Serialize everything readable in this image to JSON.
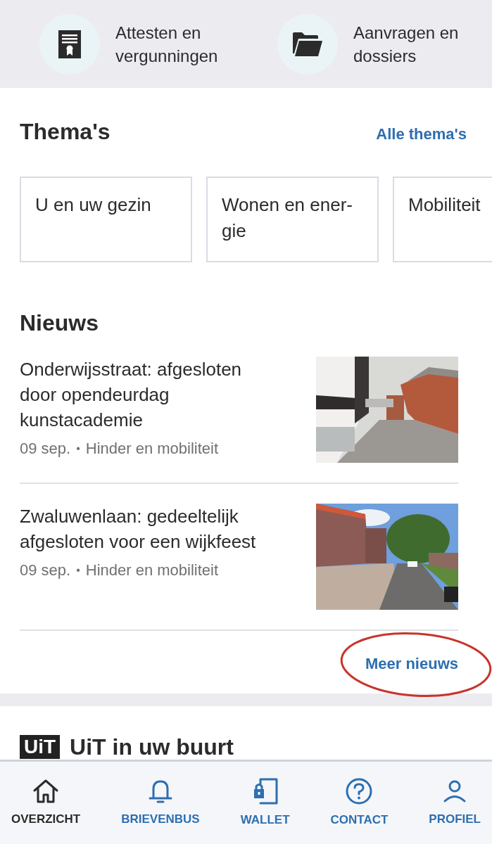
{
  "quick_links": [
    {
      "kind": "certificate",
      "label": "Attesten en vergunningen"
    },
    {
      "kind": "folder",
      "label": "Aanvragen en dossiers"
    }
  ],
  "themes": {
    "title": "Thema's",
    "link": "Alle thema's",
    "cards": [
      "U en uw gezin",
      "Wonen en ener-gie",
      "Mobiliteit"
    ]
  },
  "news": {
    "title": "Nieuws",
    "items": [
      {
        "title": "Onderwijsstraat: afgesloten door opendeurdag kunstacademie",
        "date": "09 sep.",
        "separator": "•",
        "category": "Hinder en mobiliteit"
      },
      {
        "title": "Zwaluwenlaan: gedeeltelijk afgesloten voor een wijkfeest",
        "date": "09 sep.",
        "separator": "•",
        "category": "Hinder en mobiliteit"
      }
    ],
    "more": "Meer nieuws"
  },
  "uit": {
    "logo": "UiT",
    "title": "UiT in uw buurt"
  },
  "nav": [
    {
      "kind": "home",
      "label": "OVERZICHT",
      "selected": true
    },
    {
      "kind": "bell",
      "label": "BRIEVENBUS",
      "selected": false
    },
    {
      "kind": "wallet",
      "label": "WALLET",
      "selected": false
    },
    {
      "kind": "help",
      "label": "CONTACT",
      "selected": false
    },
    {
      "kind": "user",
      "label": "PROFIEL",
      "selected": false
    }
  ]
}
